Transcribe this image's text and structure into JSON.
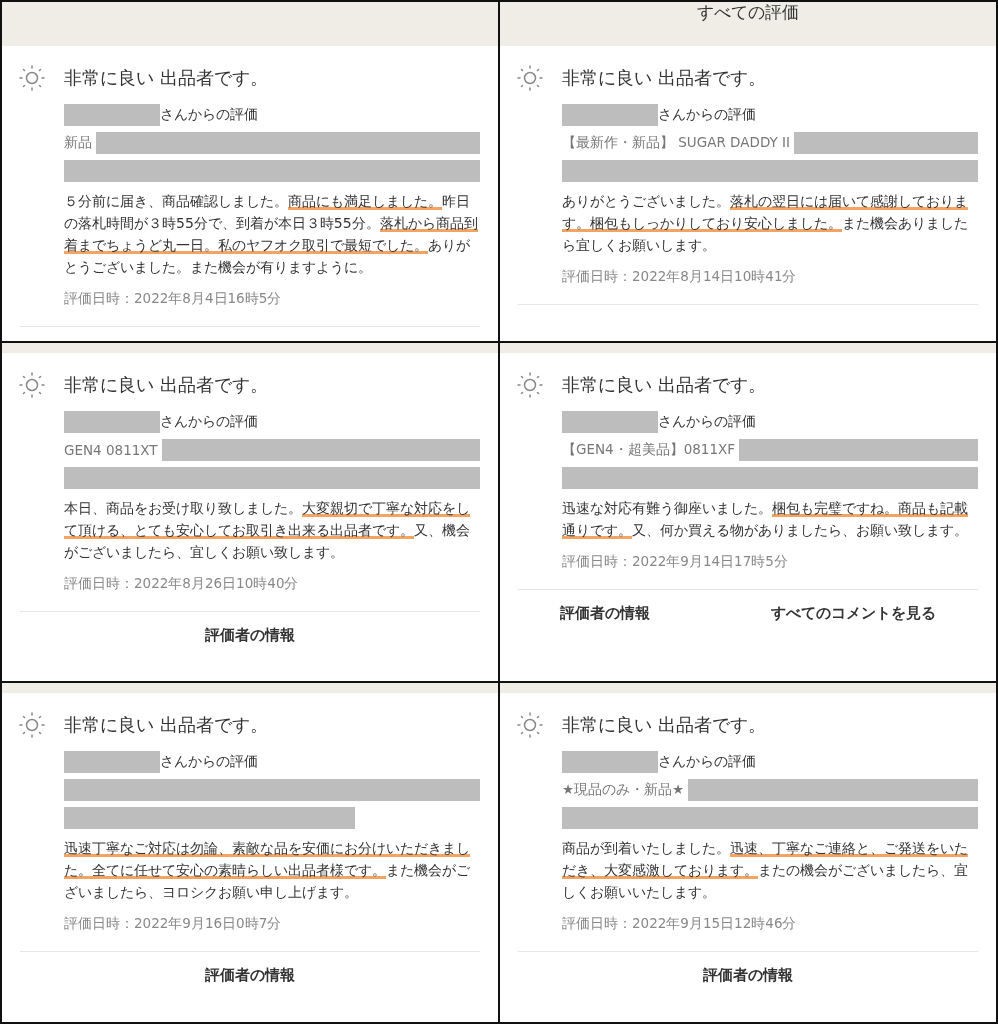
{
  "page_title": "すべての評価",
  "panels": [
    {
      "kind": "top",
      "review": {
        "rating": "非常に良い 出品者です。",
        "reviewer_suffix": "さんからの評価",
        "product_prefix": "新品",
        "comment": [
          {
            "text": "５分前に届き、商品確認しました。",
            "underlined": false
          },
          {
            "text": "商品にも満足しました。",
            "underlined": true
          },
          {
            "text": "昨日の落札時間が３時55分で、到着が本日３時55分。",
            "underlined": false
          },
          {
            "text": "落札から商品到着までちょうど丸一日。私のヤフオク取引で最短でした。",
            "underlined": true
          },
          {
            "text": "ありがとうございました。また機会が有りますように。",
            "underlined": false
          }
        ],
        "date": "評価日時：2022年8月4日16時5分"
      }
    },
    {
      "kind": "top",
      "review": {
        "rating": "非常に良い 出品者です。",
        "reviewer_suffix": "さんからの評価",
        "product_prefix": "【最新作・新品】 SUGAR DADDY II",
        "comment": [
          {
            "text": "ありがとうございました。",
            "underlined": false
          },
          {
            "text": "落札の翌日には届いて感謝しております。梱包もしっかりしており安心しました。",
            "underlined": true
          },
          {
            "text": "また機会ありましたら宜しくお願いします。",
            "underlined": false
          }
        ],
        "date": "評価日時：2022年8月14日10時41分"
      }
    },
    {
      "review": {
        "rating": "非常に良い 出品者です。",
        "reviewer_suffix": "さんからの評価",
        "product_prefix": "GEN4 0811XT",
        "comment": [
          {
            "text": "本日、商品をお受け取り致しました。",
            "underlined": false
          },
          {
            "text": "大変親切で丁寧な対応をして頂ける、とても安心してお取引き出来る出品者です。",
            "underlined": true
          },
          {
            "text": "又、機会がございましたら、宜しくお願い致します。",
            "underlined": false
          }
        ],
        "date": "評価日時：2022年8月26日10時40分"
      },
      "footer_links": [
        "評価者の情報"
      ]
    },
    {
      "review": {
        "rating": "非常に良い 出品者です。",
        "reviewer_suffix": "さんからの評価",
        "product_prefix": "【GEN4・超美品】0811XF",
        "comment": [
          {
            "text": "迅速な対応有難う御座いました。",
            "underlined": false
          },
          {
            "text": "梱包も完璧ですね。商品も記載通りです。",
            "underlined": true
          },
          {
            "text": "又、何か買える物がありましたら、お願い致します。",
            "underlined": false
          }
        ],
        "date": "評価日時：2022年9月14日17時5分"
      },
      "footer_links": [
        "評価者の情報",
        "すべてのコメントを見る"
      ]
    },
    {
      "review": {
        "rating": "非常に良い 出品者です。",
        "reviewer_suffix": "さんからの評価",
        "comment": [
          {
            "text": "迅速丁寧なご対応は勿論、素敵な品を安価にお分けいただきました。全てに任せて安心の素晴らしい出品者様です。",
            "underlined": true
          },
          {
            "text": "また機会がございましたら、ヨロシクお願い申し上げます。",
            "underlined": false
          }
        ],
        "date": "評価日時：2022年9月16日0時7分"
      },
      "footer_links": [
        "評価者の情報"
      ]
    },
    {
      "review": {
        "rating": "非常に良い 出品者です。",
        "reviewer_suffix": "さんからの評価",
        "product_prefix": "★現品のみ・新品★",
        "comment": [
          {
            "text": "商品が到着いたしました。",
            "underlined": false
          },
          {
            "text": "迅速、丁寧なご連絡と、ご発送をいただき、大変感激しております。",
            "underlined": true
          },
          {
            "text": "またの機会がございましたら、宜しくお願いいたします。",
            "underlined": false
          }
        ],
        "date": "評価日時：2022年9月15日12時46分"
      },
      "footer_links": [
        "評価者の情報"
      ]
    }
  ]
}
